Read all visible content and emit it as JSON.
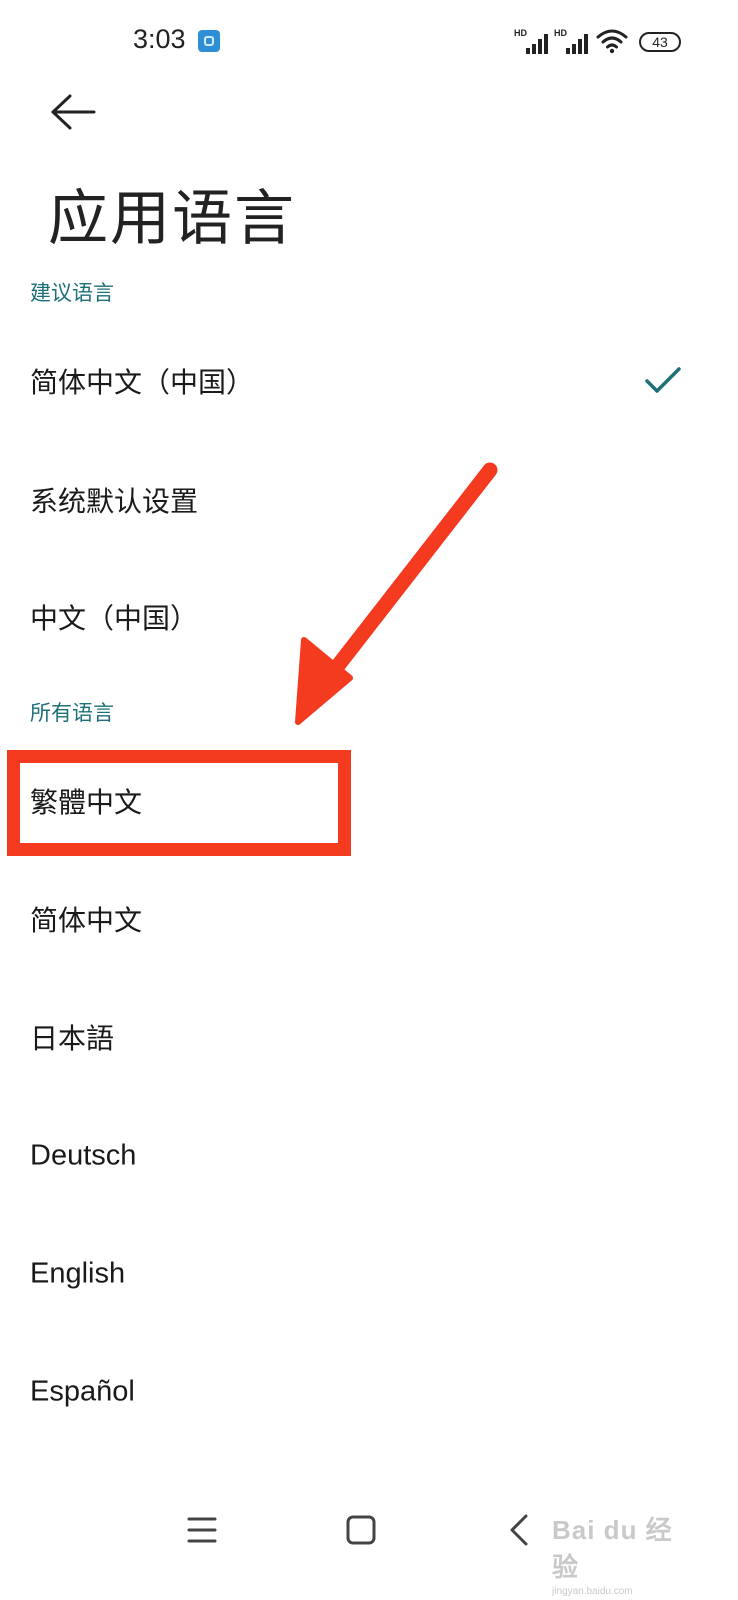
{
  "status_bar": {
    "time": "3:03",
    "signal1_label": "HD",
    "signal2_label": "HD",
    "battery": "43"
  },
  "header": {
    "title": "应用语言"
  },
  "sections": {
    "suggested": "建议语言",
    "all": "所有语言"
  },
  "suggested_languages": [
    {
      "label": "简体中文（中国）",
      "selected": true
    },
    {
      "label": "系统默认设置"
    },
    {
      "label": "中文（中国）"
    }
  ],
  "all_languages": [
    {
      "label": "繁體中文"
    },
    {
      "label": "简体中文"
    },
    {
      "label": "日本語"
    },
    {
      "label": "Deutsch"
    },
    {
      "label": "English"
    },
    {
      "label": "Español"
    }
  ],
  "watermark": {
    "main": "Bai du 经验",
    "sub": "jingyan.baidu.com"
  },
  "colors": {
    "accent": "#1d6f78",
    "annotation": "#f43a1f"
  },
  "icons": [
    "back-arrow-icon",
    "check-icon",
    "menu-icon",
    "home-icon",
    "back-nav-icon",
    "wifi-icon",
    "signal-icon",
    "battery-icon"
  ]
}
